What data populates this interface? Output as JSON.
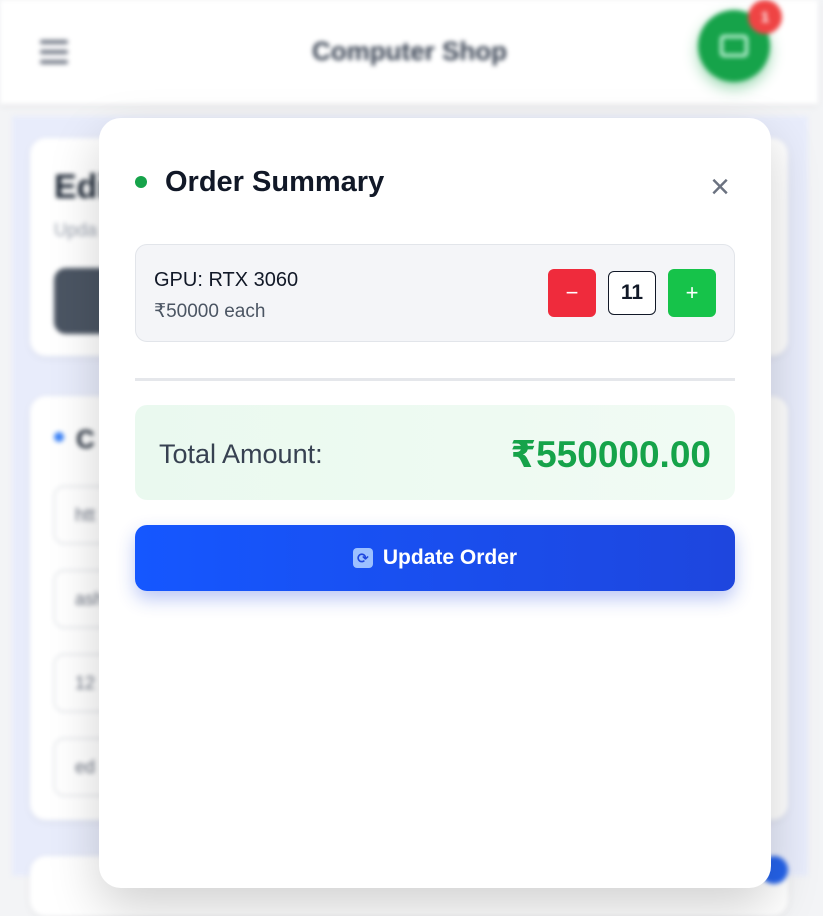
{
  "header": {
    "brand": "Computer Shop",
    "cart_count": "1"
  },
  "background": {
    "card1_title": "Edi",
    "card1_subtitle": "Upda",
    "card2_title": "C",
    "inputs": [
      "htt",
      "ash",
      "12",
      "ed"
    ]
  },
  "modal": {
    "title": "Order Summary",
    "close_glyph": "×",
    "item": {
      "name": "GPU: RTX 3060",
      "price": "₹50000 each",
      "quantity": "11",
      "minus_glyph": "−",
      "plus_glyph": "+"
    },
    "total_label": "Total Amount:",
    "total_value": "₹550000.00",
    "update_button": "Update Order",
    "update_icon_glyph": "⟳"
  },
  "colors": {
    "accent_green": "#16a34a",
    "accent_blue": "#1557ff",
    "danger_red": "#ef2b3c"
  },
  "icons": {
    "menu": "hamburger-menu-icon",
    "cart": "cart-icon",
    "close": "close-icon",
    "refresh": "refresh-icon"
  }
}
